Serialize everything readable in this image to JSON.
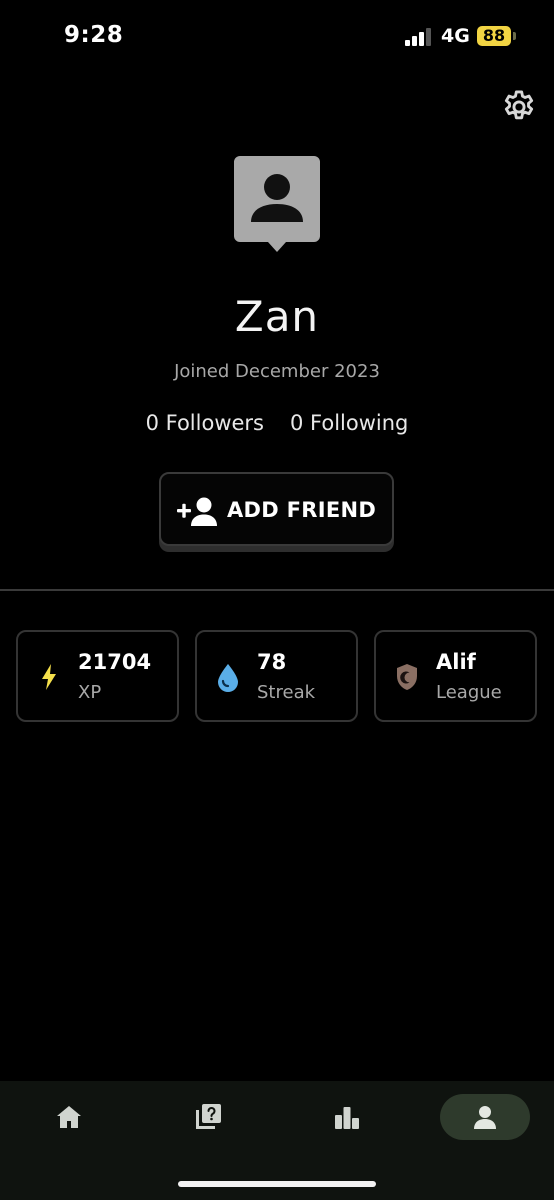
{
  "status_bar": {
    "time": "9:28",
    "network": "4G",
    "battery": "88"
  },
  "profile": {
    "name": "Zan",
    "joined": "Joined December 2023",
    "followers": "0 Followers",
    "following": "0 Following"
  },
  "actions": {
    "add_friend_label": "ADD FRIEND"
  },
  "stats": [
    {
      "value": "21704",
      "label": "XP",
      "icon": "lightning-icon",
      "color": "#f5e04b"
    },
    {
      "value": "78",
      "label": "Streak",
      "icon": "water-drop-icon",
      "color": "#5aaee8"
    },
    {
      "value": "Alif",
      "label": "League",
      "icon": "shield-icon",
      "color": "#8a6f63"
    }
  ],
  "nav": {
    "items": [
      {
        "icon": "home-icon"
      },
      {
        "icon": "quiz-cards-icon"
      },
      {
        "icon": "leaderboard-icon"
      },
      {
        "icon": "profile-icon",
        "active": true
      }
    ]
  },
  "colors": {
    "accent_battery": "#f2d443",
    "nav_active_bg": "#2e3a2c",
    "card_border": "#343434"
  }
}
